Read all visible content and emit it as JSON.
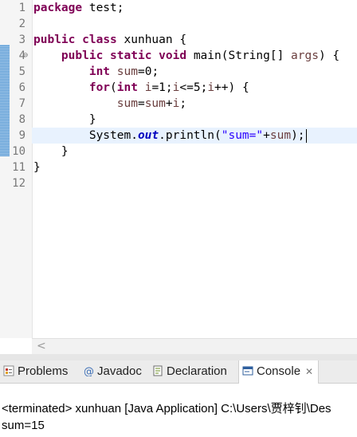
{
  "editor": {
    "lines": [
      {
        "num": "1",
        "tokens": [
          {
            "t": "package",
            "c": "kw"
          },
          {
            "t": " test;"
          }
        ]
      },
      {
        "num": "2",
        "tokens": []
      },
      {
        "num": "3",
        "tokens": [
          {
            "t": "public",
            "c": "kw"
          },
          {
            "t": " "
          },
          {
            "t": "class",
            "c": "kw"
          },
          {
            "t": " xunhuan {"
          }
        ]
      },
      {
        "num": "4",
        "fold": "⊖",
        "tokens": [
          {
            "t": "    "
          },
          {
            "t": "public",
            "c": "kw"
          },
          {
            "t": " "
          },
          {
            "t": "static",
            "c": "kw"
          },
          {
            "t": " "
          },
          {
            "t": "void",
            "c": "kw"
          },
          {
            "t": " main(String[] "
          },
          {
            "t": "args",
            "c": "var"
          },
          {
            "t": ") {"
          }
        ]
      },
      {
        "num": "5",
        "tokens": [
          {
            "t": "        "
          },
          {
            "t": "int",
            "c": "kw"
          },
          {
            "t": " "
          },
          {
            "t": "sum",
            "c": "var"
          },
          {
            "t": "=0;"
          }
        ]
      },
      {
        "num": "6",
        "tokens": [
          {
            "t": "        "
          },
          {
            "t": "for",
            "c": "kw"
          },
          {
            "t": "("
          },
          {
            "t": "int",
            "c": "kw"
          },
          {
            "t": " "
          },
          {
            "t": "i",
            "c": "var"
          },
          {
            "t": "=1;"
          },
          {
            "t": "i",
            "c": "var"
          },
          {
            "t": "<=5;"
          },
          {
            "t": "i",
            "c": "var"
          },
          {
            "t": "++) {"
          }
        ]
      },
      {
        "num": "7",
        "tokens": [
          {
            "t": "            "
          },
          {
            "t": "sum",
            "c": "var"
          },
          {
            "t": "="
          },
          {
            "t": "sum",
            "c": "var"
          },
          {
            "t": "+"
          },
          {
            "t": "i",
            "c": "var"
          },
          {
            "t": ";"
          }
        ]
      },
      {
        "num": "8",
        "tokens": [
          {
            "t": "        }"
          }
        ]
      },
      {
        "num": "9",
        "current": true,
        "tokens": [
          {
            "t": "        System."
          },
          {
            "t": "out",
            "c": "fld"
          },
          {
            "t": ".println("
          },
          {
            "t": "\"sum=\"",
            "c": "str"
          },
          {
            "t": "+"
          },
          {
            "t": "sum",
            "c": "var"
          },
          {
            "t": ");"
          }
        ]
      },
      {
        "num": "10",
        "tokens": [
          {
            "t": "    }"
          }
        ]
      },
      {
        "num": "11",
        "tokens": [
          {
            "t": "}"
          }
        ]
      },
      {
        "num": "12",
        "tokens": []
      }
    ]
  },
  "scroll": {
    "left_arrow": "<"
  },
  "tabs": [
    {
      "label": "Problems",
      "icon": "problems-icon",
      "color": "#c0392b"
    },
    {
      "label": "Javadoc",
      "icon": "javadoc-icon",
      "color": "#3d6fb6"
    },
    {
      "label": "Declaration",
      "icon": "declaration-icon",
      "color": "#6b8e23"
    },
    {
      "label": "Console",
      "icon": "console-icon",
      "color": "#2f5f9e",
      "active": true,
      "close": "✕"
    }
  ],
  "console": {
    "header": "<terminated> xunhuan [Java Application] C:\\Users\\贾梓钊\\Des",
    "output": "sum=15"
  }
}
